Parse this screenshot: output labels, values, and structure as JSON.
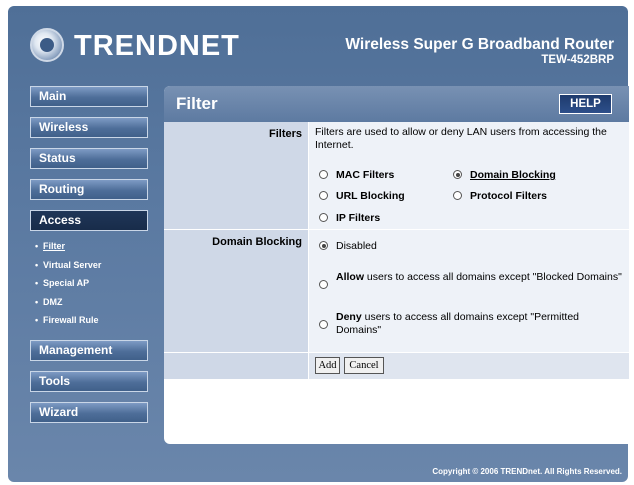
{
  "header": {
    "logo": "TRENDNET",
    "product": "Wireless Super G Broadband Router",
    "model": "TEW-452BRP"
  },
  "nav": {
    "items": [
      {
        "label": "Main"
      },
      {
        "label": "Wireless"
      },
      {
        "label": "Status"
      },
      {
        "label": "Routing"
      },
      {
        "label": "Access",
        "active": true
      },
      {
        "label": "Management"
      },
      {
        "label": "Tools"
      },
      {
        "label": "Wizard"
      }
    ],
    "access_sub": [
      {
        "label": "Filter",
        "current": true
      },
      {
        "label": "Virtual Server"
      },
      {
        "label": "Special AP"
      },
      {
        "label": "DMZ"
      },
      {
        "label": "Firewall Rule"
      }
    ]
  },
  "panel": {
    "title": "Filter",
    "help_label": "HELP",
    "filters": {
      "label": "Filters",
      "description": "Filters are used to allow or deny LAN users from accessing the Internet.",
      "options": [
        {
          "label": "MAC Filters",
          "selected": false
        },
        {
          "label": "Domain Blocking",
          "selected": true
        },
        {
          "label": "URL Blocking",
          "selected": false
        },
        {
          "label": "Protocol Filters",
          "selected": false
        },
        {
          "label": "IP Filters",
          "selected": false
        }
      ]
    },
    "domain_blocking": {
      "label": "Domain Blocking",
      "disabled_label": "Disabled",
      "allow_bold": "Allow",
      "allow_text": " users to access all domains except \"Blocked Domains\"",
      "deny_bold": "Deny",
      "deny_text": " users to access all domains except \"Permitted Domains\""
    },
    "buttons": {
      "add": "Add",
      "cancel": "Cancel"
    }
  },
  "footer": "Copyright © 2006 TRENDnet. All Rights Reserved."
}
